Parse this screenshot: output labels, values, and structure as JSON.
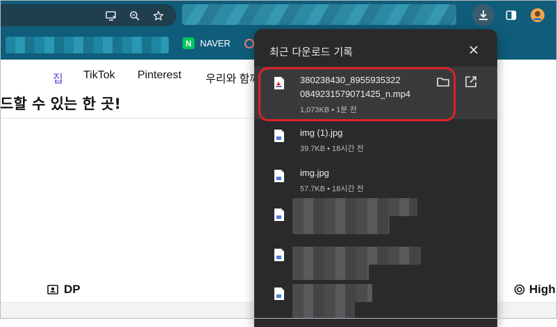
{
  "toolbar": {
    "icons": [
      "cast-icon",
      "zoom-icon",
      "star-icon",
      "download-icon",
      "side-panel-icon",
      "profile-avatar"
    ]
  },
  "bookmarks": {
    "naver_badge": "N",
    "naver_label": "NAVER"
  },
  "page": {
    "nav": [
      "집",
      "TikTok",
      "Pinterest",
      "우리와 함께"
    ],
    "headline": "드할 수 있는 한 곳!",
    "dp_label": "DP",
    "high_label": "High"
  },
  "downloads": {
    "title": "최근 다운로드 기록",
    "items": [
      {
        "name_line1": "380238430_8955935322",
        "name_line2": "0849231579071425_n.mp4",
        "meta": "1,073KB • 1분 전"
      },
      {
        "name": "img (1).jpg",
        "meta": "39.7KB • 18시간 전"
      },
      {
        "name": "img.jpg",
        "meta": "57.7KB • 18시간 전"
      }
    ]
  },
  "colors": {
    "chrome": "#0f5d7a",
    "panel": "#2a2a2c",
    "highlight": "#e0202a",
    "active_nav": "#5a3fd6"
  }
}
